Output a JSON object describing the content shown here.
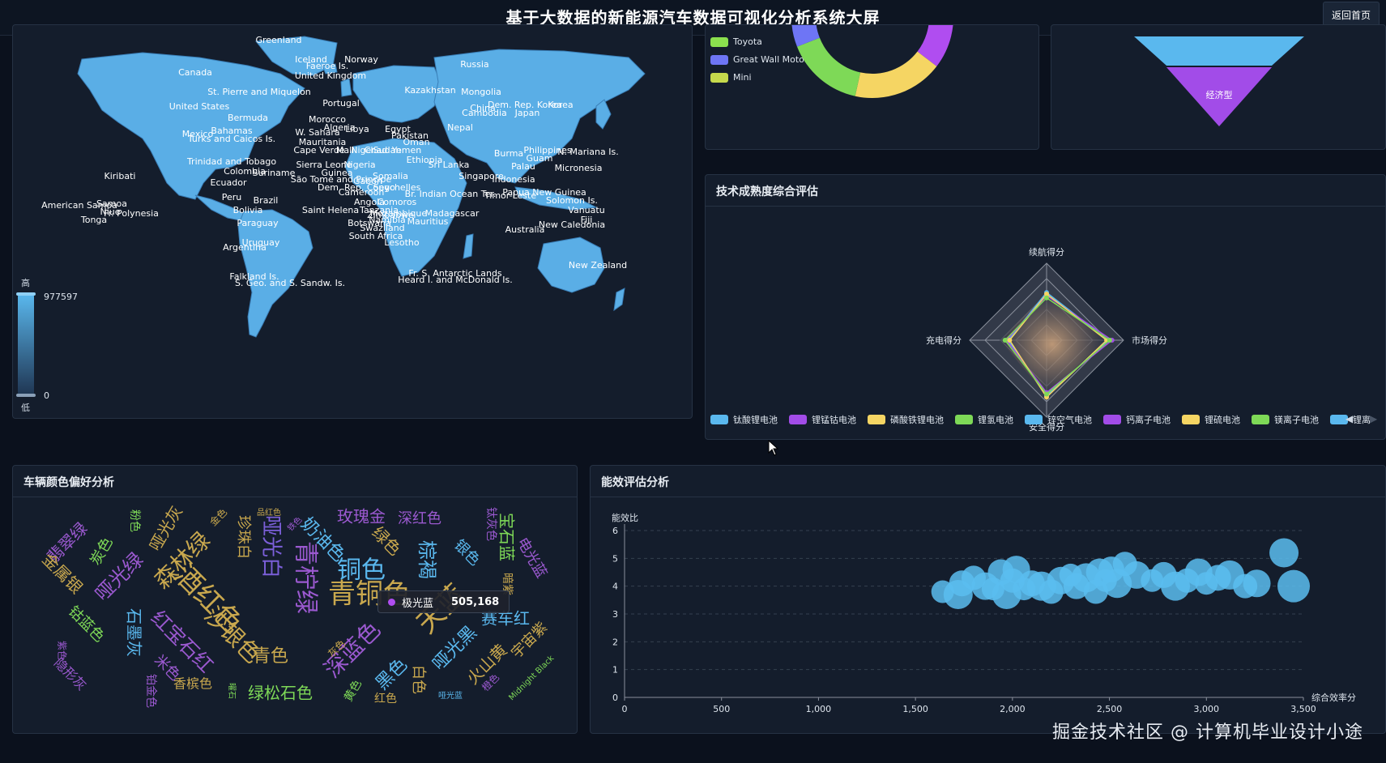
{
  "header": {
    "title": "基于大数据的新能源汽车数据可视化分析系统大屏",
    "back_label": "返回首页"
  },
  "map_panel": {
    "visual_map": {
      "max_label": "977597",
      "min_label": "0",
      "high_text": "高",
      "low_text": "低"
    },
    "countries": [
      "Greenland",
      "Iceland",
      "Faeroe Is.",
      "Norway",
      "Russia",
      "Canada",
      "United Kingdom",
      "Kazakhstan",
      "Mongolia",
      "St. Pierre and Miquelon",
      "Portugal",
      "Dem. Rep. Korea",
      "Korea",
      "United States",
      "China",
      "Japan",
      "Bermuda",
      "Morocco",
      "Algeria",
      "Libya",
      "Egypt",
      "Pakistan",
      "Nepal",
      "Mexico",
      "Bahamas",
      "Turks and Caicos Is.",
      "W. Sahara",
      "Mauritania",
      "Niger",
      "Chad",
      "Sudan",
      "Yemen",
      "Oman",
      "Philippines",
      "N. Mariana Is.",
      "Guam",
      "Cape Verde",
      "Mali",
      "Ethiopia",
      "Sri Lanka",
      "Palau",
      "Micronesia",
      "Trinidad and Tobago",
      "Sierra Leone",
      "Nigeria",
      "Somalia",
      "Kiribati",
      "Colombia",
      "Suriname",
      "São Tomé and Principe",
      "Gabon",
      "Singapore",
      "Indonesia",
      "Ecuador",
      "Dem. Rep. Congo",
      "Seychelles",
      "Papua New Guinea",
      "Solomon Is.",
      "Peru",
      "Brazil",
      "Angola",
      "Comoros",
      "Br. Indian Ocean Ter.",
      "Timor-Leste",
      "Vanuatu",
      "Fiji",
      "Samoa",
      "American Samoa",
      "Bolivia",
      "Saint Helena",
      "Mozambique",
      "Niue",
      "Fr. Polynesia",
      "Tonga",
      "Namibia",
      "Botswana",
      "Mauritius",
      "New Caledonia",
      "Paraguay",
      "Swaziland",
      "Australia",
      "Uruguay",
      "South Africa",
      "Argentina",
      "New Zealand",
      "Falkland Is.",
      "S. Geo. and S. Sandw. Is.",
      "Fr. S. Antarctic Lands",
      "Heard I. and McDonald Is.",
      "Cambodia",
      "Burma",
      "Lesotho",
      "Zimbabwe",
      "Tanzania",
      "Madagascar",
      "Cameroon",
      "Guinea"
    ]
  },
  "brand_panel": {
    "legend": [
      {
        "label": "Toyota",
        "color": "#8be04e"
      },
      {
        "label": "Great Wall Motors",
        "color": "#6e75f5"
      },
      {
        "label": "Mini",
        "color": "#c5d94c"
      }
    ],
    "donut": [
      {
        "value": 22,
        "color": "#b04df0"
      },
      {
        "value": 30,
        "color": "#f5d563"
      },
      {
        "value": 26,
        "color": "#7ed957"
      },
      {
        "value": 22,
        "color": "#6e75f5"
      }
    ]
  },
  "funnel_panel": {
    "top_color": "#5ab8ee",
    "bottom_label": "经济型",
    "bottom_color": "#a24ce8"
  },
  "radar_panel": {
    "title": "技术成熟度综合评估",
    "axes": [
      "续航得分",
      "市场得分",
      "安全得分",
      "充电得分"
    ],
    "legend": [
      {
        "label": "钛酸锂电池",
        "color": "#5ab8ee"
      },
      {
        "label": "锂锰钴电池",
        "color": "#a24ce8"
      },
      {
        "label": "磷酸铁锂电池",
        "color": "#f5d563"
      },
      {
        "label": "锂氢电池",
        "color": "#7ed957"
      },
      {
        "label": "锌空气电池",
        "color": "#5ab8ee"
      },
      {
        "label": "钙离子电池",
        "color": "#a24ce8"
      },
      {
        "label": "锂硫电池",
        "color": "#f5d563"
      },
      {
        "label": "镁离子电池",
        "color": "#7ed957"
      },
      {
        "label": "锂离",
        "color": "#5ab8ee"
      }
    ],
    "series_colors": [
      "#5ab8ee",
      "#a24ce8",
      "#f5d563",
      "#7ed957"
    ]
  },
  "wordcloud_panel": {
    "title": "车辆颜色偏好分析",
    "words": [
      {
        "text": "翡翠绿",
        "color": "#9b59d0"
      },
      {
        "text": "金属银",
        "color": "#c9a84e"
      },
      {
        "text": "炭色",
        "color": "#7ed957"
      },
      {
        "text": "哑光绿",
        "color": "#9b59d0"
      },
      {
        "text": "粉色",
        "color": "#7ed957"
      },
      {
        "text": "哑光灰",
        "color": "#c9a84e"
      },
      {
        "text": "森林绿",
        "color": "#c9a84e"
      },
      {
        "text": "珍珠白",
        "color": "#c9a84e"
      },
      {
        "text": "哑光白",
        "color": "#7b5fd9"
      },
      {
        "text": "奶油色",
        "color": "#5ab8ee"
      },
      {
        "text": "玫瑰金",
        "color": "#9b59d0"
      },
      {
        "text": "深红色",
        "color": "#9b59d0"
      },
      {
        "text": "绿色",
        "color": "#c9a84e"
      },
      {
        "text": "铜色",
        "color": "#5ab8ee"
      },
      {
        "text": "青柠绿",
        "color": "#9b59d0"
      },
      {
        "text": "酒红色",
        "color": "#c9a84e"
      },
      {
        "text": "银色",
        "color": "#5ab8ee"
      },
      {
        "text": "青铜色",
        "color": "#c9a84e"
      },
      {
        "text": "棕褐",
        "color": "#5ab8ee"
      },
      {
        "text": "宝石蓝",
        "color": "#7ed957"
      },
      {
        "text": "电光蓝",
        "color": "#9b59d0"
      },
      {
        "text": "极光蓝",
        "color": "#9b59d0"
      },
      {
        "text": "赛车红",
        "color": "#5ab8ee"
      },
      {
        "text": "天蓝",
        "color": "#c9a84e"
      },
      {
        "text": "沙银色",
        "color": "#c9a84e"
      },
      {
        "text": "红宝石红",
        "color": "#9b59d0"
      },
      {
        "text": "钴蓝色",
        "color": "#7ed957"
      },
      {
        "text": "石墨灰",
        "color": "#5ab8ee"
      },
      {
        "text": "米色",
        "color": "#9b59d0"
      },
      {
        "text": "隐形灰",
        "color": "#9b59d0"
      },
      {
        "text": "青色",
        "color": "#c9a84e"
      },
      {
        "text": "深蓝色",
        "color": "#9b59d0"
      },
      {
        "text": "黑色",
        "color": "#5ab8ee"
      },
      {
        "text": "哑光黑",
        "color": "#5ab8ee"
      },
      {
        "text": "火山黄",
        "color": "#c9a84e"
      },
      {
        "text": "宇宙紫",
        "color": "#c9a84e"
      },
      {
        "text": "绿松石色",
        "color": "#7ed957"
      },
      {
        "text": "香槟色",
        "color": "#c9a84e"
      },
      {
        "text": "白色",
        "color": "#c9a84e"
      },
      {
        "text": "红色",
        "color": "#c9a84e"
      },
      {
        "text": "铂金色",
        "color": "#9b59d0"
      },
      {
        "text": "紫色",
        "color": "#9b59d0"
      },
      {
        "text": "黄色",
        "color": "#7ed957"
      },
      {
        "text": "橙色",
        "color": "#9b59d0"
      },
      {
        "text": "Midnight Black",
        "color": "#7ed957"
      },
      {
        "text": "哑光蓝",
        "color": "#5ab8ee"
      },
      {
        "text": "灰色",
        "color": "#c9a84e"
      },
      {
        "text": "品红色",
        "color": "#c9a84e"
      },
      {
        "text": "金色",
        "color": "#c9a84e"
      },
      {
        "text": "铁色",
        "color": "#9b59d0"
      },
      {
        "text": "钛灰色",
        "color": "#9b59d0"
      },
      {
        "text": "曜石",
        "color": "#7ed957"
      },
      {
        "text": "暗紫",
        "color": "#c9a84e"
      }
    ],
    "tooltip": {
      "name": "极光蓝",
      "value": "505,168",
      "dot_color": "#b04df0"
    }
  },
  "efficiency_panel": {
    "title": "能效评估分析"
  },
  "chart_data": {
    "type": "scatter",
    "ylabel": "能效比",
    "xlabel": "综合效率分",
    "xlim": [
      0,
      3500
    ],
    "ylim": [
      0,
      6
    ],
    "xticks": [
      "0",
      "500",
      "1,000",
      "1,500",
      "2,000",
      "2,500",
      "3,000",
      "3,500"
    ],
    "yticks": [
      "0",
      "1",
      "2",
      "3",
      "4",
      "5",
      "6"
    ],
    "grid": true,
    "points": [
      [
        1640,
        3.8
      ],
      [
        1740,
        4.1
      ],
      [
        1720,
        3.7
      ],
      [
        1800,
        4.3
      ],
      [
        1860,
        4.0
      ],
      [
        1900,
        3.9
      ],
      [
        1940,
        4.5
      ],
      [
        1970,
        3.7
      ],
      [
        2000,
        4.2
      ],
      [
        2020,
        4.6
      ],
      [
        2060,
        3.9
      ],
      [
        2100,
        4.1
      ],
      [
        2150,
        4.0
      ],
      [
        2200,
        3.8
      ],
      [
        2250,
        4.2
      ],
      [
        2300,
        4.4
      ],
      [
        2330,
        4.0
      ],
      [
        2380,
        4.3
      ],
      [
        2430,
        3.8
      ],
      [
        2450,
        4.5
      ],
      [
        2480,
        4.2
      ],
      [
        2510,
        4.6
      ],
      [
        2540,
        4.1
      ],
      [
        2580,
        4.8
      ],
      [
        2640,
        4.4
      ],
      [
        2720,
        4.2
      ],
      [
        2780,
        4.4
      ],
      [
        2840,
        4.0
      ],
      [
        2900,
        4.2
      ],
      [
        2960,
        4.5
      ],
      [
        3000,
        4.1
      ],
      [
        3060,
        4.3
      ],
      [
        3120,
        4.4
      ],
      [
        3200,
        4.0
      ],
      [
        3260,
        4.1
      ],
      [
        3400,
        5.2
      ],
      [
        3450,
        4.0
      ]
    ],
    "point_color": "#5bbdf0"
  },
  "watermark": "掘金技术社区 @ 计算机毕业设计小途"
}
